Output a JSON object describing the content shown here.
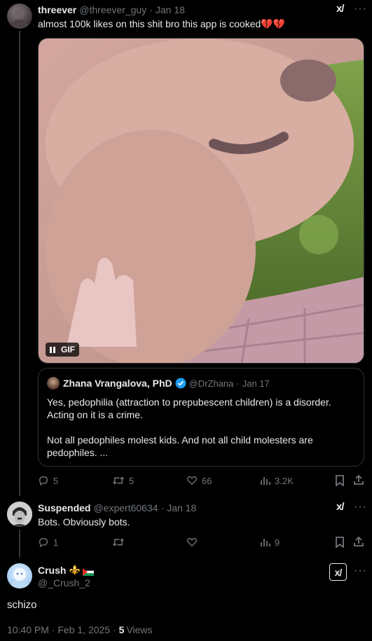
{
  "post1": {
    "display_name": "threever",
    "handle": "@threever_guy",
    "date": "Jan 18",
    "sep": "·",
    "text": "almost 100k likes on this shit bro this app is cooked💔💔",
    "gif_label": "GIF",
    "quote": {
      "display_name": "Zhana Vrangalova, PhD",
      "handle": "@DrZhana",
      "date": "Jan 17",
      "sep": "·",
      "line1": "Yes, pedophilia (attraction to prepubescent children) is a disorder.",
      "line2": "Acting on it is a crime.",
      "line3": "Not all pedophiles molest kids. And not all child molesters are",
      "line4": "pedophiles. ..."
    },
    "replies": "5",
    "reposts": "5",
    "likes": "66",
    "views": "3.2K"
  },
  "post2": {
    "display_name": "Suspended",
    "handle": "@expert60634",
    "date": "Jan 18",
    "sep": "·",
    "text": "Bots. Obviously bots.",
    "replies": "1",
    "reposts": "",
    "likes": "",
    "views": "9"
  },
  "main_post": {
    "display_name": "Crush",
    "emoji": "⚜️",
    "handle": "@_Crush_2",
    "text": "schizo",
    "timestamp": "10:40 PM · Feb 1, 2025 ·",
    "views_count": "5",
    "views_label": "Views"
  },
  "colors": {
    "background": "#000000",
    "text": "#e7e9ea",
    "muted": "#71767b",
    "border": "#2f3336",
    "verified": "#1d9bf0"
  }
}
